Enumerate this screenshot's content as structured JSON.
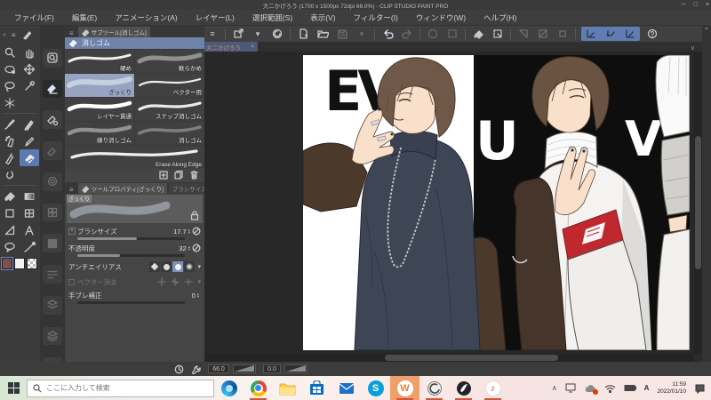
{
  "window": {
    "title": "大二かげろう (1700 x 1500px 72dpi 66.0%) - CLIP STUDIO PAINT PRO"
  },
  "menu": {
    "items": [
      "ファイル(F)",
      "編集(E)",
      "アニメーション(A)",
      "レイヤー(L)",
      "選択範囲(S)",
      "表示(V)",
      "フィルター(I)",
      "ウィンドウ(W)",
      "ヘルプ(H)"
    ]
  },
  "canvas_tab": {
    "label": "大二かげろう"
  },
  "subtool": {
    "tab": "サブツール[消しゴム]",
    "group_label": "消しゴム",
    "selected_index": 2,
    "items": [
      "硬め",
      "軟らかめ",
      "ざっくり",
      "ベクター用",
      "レイヤー貫通",
      "スナップ消しゴム",
      "練り消しゴム",
      "消しゴム",
      "Erase Along Edge"
    ]
  },
  "tool_property": {
    "tab_active": "ツールプロパティ[ざっくり]",
    "tab_inactive": "ブラシサイズ[ざっくり]",
    "preview_label": "ざっくり",
    "brush_size_label": "ブラシサイズ",
    "brush_size_value": "17.7",
    "opacity_label": "不透明度",
    "opacity_value": "32",
    "antialias_label": "アンチエイリアス",
    "vector_erase_label": "ベクター消去",
    "stabilize_label": "手ブレ補正",
    "stabilize_value": "0"
  },
  "statusbar": {
    "zoom": "66.0",
    "rotation": "0.0"
  },
  "artwork": {
    "letters": {
      "topleft": "EV",
      "center": "U",
      "right": "V"
    }
  },
  "taskbar": {
    "search_placeholder": "ここに入力して検索",
    "skype_glyph": "S",
    "active_app_glyph": "W",
    "tray": {
      "ime": "A",
      "time": "11:59",
      "date": "2022/01/10"
    }
  },
  "glyphs": {
    "hamburger": "≡",
    "collapse_left": "«",
    "collapse_right": "»",
    "chevron_down": "∨",
    "dropdown": "▾",
    "step_up": "▴",
    "step_down": "▾",
    "tray_caret": "∧",
    "note": "♪",
    "plus": "+",
    "close": "×",
    "minimize": "─",
    "maximize": "□"
  },
  "colors": {
    "accent_blue": "#6e82aa",
    "selected_cell": "#97a3c0",
    "tool_selected": "#5d7ab0",
    "taskbar_underline": "#d2543a",
    "active_app_bg": "#efa06a",
    "main_color": "#7d5050",
    "armband_red": "#c02830"
  }
}
